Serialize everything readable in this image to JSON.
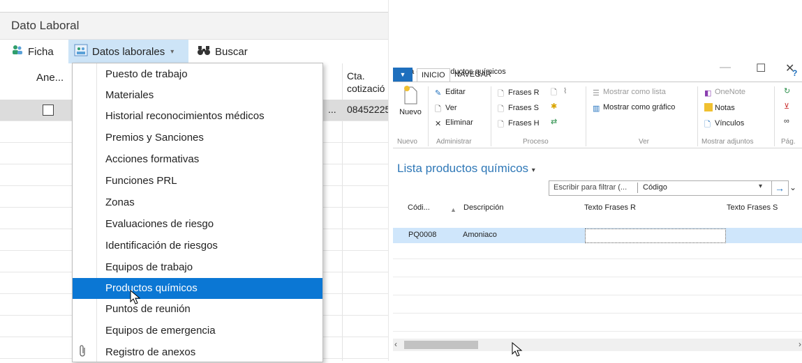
{
  "left": {
    "title": "Dato Laboral",
    "toolbar": {
      "ficha": "Ficha",
      "datos_laborales": "Datos laborales",
      "buscar": "Buscar"
    },
    "grid": {
      "col_anexo": "Ane...",
      "col_cta_line1": "Cta.",
      "col_cta_line2": "cotizació",
      "row1_cell_a": "...",
      "row1_cell_b": "08452225"
    }
  },
  "dropdown": {
    "items": [
      {
        "label": "Puesto de trabajo"
      },
      {
        "label": "Materiales"
      },
      {
        "label": "Historial reconocimientos médicos"
      },
      {
        "label": "Premios y Sanciones"
      },
      {
        "label": "Acciones formativas"
      },
      {
        "label": "Funciones PRL"
      },
      {
        "label": "Zonas"
      },
      {
        "label": "Evaluaciones de riesgo"
      },
      {
        "label": "Identificación de riesgos"
      },
      {
        "label": "Equipos de trabajo"
      },
      {
        "label": "Productos químicos"
      },
      {
        "label": "Puntos de reunión"
      },
      {
        "label": "Equipos de emergencia"
      },
      {
        "label": "Registro de anexos"
      }
    ],
    "highlighted_index": 10
  },
  "right": {
    "window_title": "Vista - Lista productos químicos",
    "controls": {
      "minimize": "—",
      "maximize": "☐",
      "close": "✕"
    },
    "tabs": {
      "inicio": "INICIO",
      "navegar": "NAVEGAR"
    },
    "ribbon": {
      "nuevo": "Nuevo",
      "editar": "Editar",
      "ver": "Ver",
      "eliminar": "Eliminar",
      "frases_r": "Frases R",
      "frases_s": "Frases S",
      "frases_h": "Frases H",
      "mostrar_lista": "Mostrar como lista",
      "mostrar_grafico": "Mostrar como gráfico",
      "onenote": "OneNote",
      "notas": "Notas",
      "vinculos": "Vínculos",
      "groups": {
        "nuevo": "Nuevo",
        "administrar": "Administrar",
        "proceso": "Proceso",
        "ver": "Ver",
        "adjuntos": "Mostrar adjuntos",
        "pag": "Pág."
      }
    },
    "page_title": "Lista productos químicos",
    "filter": {
      "placeholder": "Escribir para filtrar (...",
      "field": "Código"
    },
    "columns": {
      "codigo": "Códi...",
      "descripcion": "Descripción",
      "texto_r": "Texto Frases R",
      "texto_s": "Texto Frases S"
    },
    "rows": [
      {
        "codigo": "PQ0008",
        "descripcion": "Amoniaco"
      }
    ]
  },
  "colors": {
    "menu_highlight": "#0b77d4",
    "selected_row_right": "#cfe6fb",
    "accent_title": "#2f78b7",
    "file_tab": "#1e6fbd"
  }
}
